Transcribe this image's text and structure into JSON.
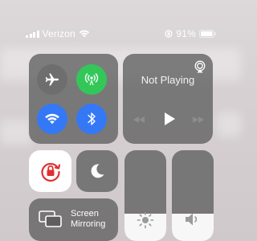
{
  "status_bar": {
    "carrier": "Verizon",
    "battery": "91%"
  },
  "connectivity": {
    "airplane_icon": "airplane-icon",
    "cellular_icon": "cellular-antenna-icon",
    "wifi_icon": "wifi-icon",
    "bluetooth_icon": "bluetooth-icon",
    "colors": {
      "inactive": "#6e6e6e",
      "cellular_on": "#33c759",
      "wifi_on": "#3478f6",
      "bluetooth_on": "#3478f6"
    }
  },
  "now_playing": {
    "title": "Not Playing"
  },
  "screen_mirroring": {
    "label": "Screen Mirroring"
  },
  "sliders": {
    "brightness_level": 0.3,
    "volume_level": 0.3
  }
}
